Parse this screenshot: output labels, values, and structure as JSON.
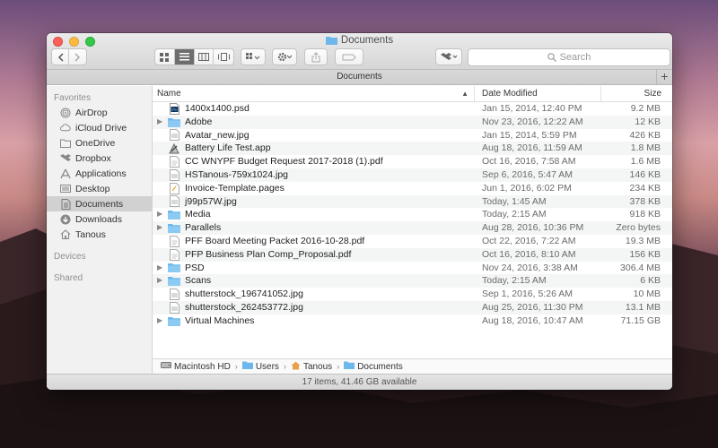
{
  "window": {
    "title": "Documents",
    "tab_label": "Documents",
    "search_placeholder": "Search",
    "status": "17 items, 41.46 GB available"
  },
  "sidebar": {
    "favorites_label": "Favorites",
    "devices_label": "Devices",
    "shared_label": "Shared",
    "items": [
      {
        "label": "AirDrop",
        "icon": "airdrop-icon"
      },
      {
        "label": "iCloud Drive",
        "icon": "cloud-icon"
      },
      {
        "label": "OneDrive",
        "icon": "folder-icon"
      },
      {
        "label": "Dropbox",
        "icon": "dropbox-icon"
      },
      {
        "label": "Applications",
        "icon": "applications-icon"
      },
      {
        "label": "Desktop",
        "icon": "desktop-icon"
      },
      {
        "label": "Documents",
        "icon": "documents-icon"
      },
      {
        "label": "Downloads",
        "icon": "downloads-icon"
      },
      {
        "label": "Tanous",
        "icon": "home-icon"
      }
    ]
  },
  "columns": {
    "name": "Name",
    "date": "Date Modified",
    "size": "Size"
  },
  "files": [
    {
      "name": "1400x1400.psd",
      "date": "Jan 15, 2014, 12:40 PM",
      "size": "9.2 MB",
      "kind": "psd",
      "folder": false
    },
    {
      "name": "Adobe",
      "date": "Nov 23, 2016, 12:22 AM",
      "size": "12 KB",
      "kind": "folder",
      "folder": true
    },
    {
      "name": "Avatar_new.jpg",
      "date": "Jan 15, 2014, 5:59 PM",
      "size": "426 KB",
      "kind": "image",
      "folder": false
    },
    {
      "name": "Battery Life Test.app",
      "date": "Aug 18, 2016, 11:59 AM",
      "size": "1.8 MB",
      "kind": "app",
      "folder": false
    },
    {
      "name": "CC WNYPF Budget Request 2017-2018 (1).pdf",
      "date": "Oct 16, 2016, 7:58 AM",
      "size": "1.6 MB",
      "kind": "pdf",
      "folder": false
    },
    {
      "name": "HSTanous-759x1024.jpg",
      "date": "Sep 6, 2016, 5:47 AM",
      "size": "146 KB",
      "kind": "image",
      "folder": false
    },
    {
      "name": "Invoice-Template.pages",
      "date": "Jun 1, 2016, 6:02 PM",
      "size": "234 KB",
      "kind": "doc",
      "folder": false
    },
    {
      "name": "j99p57W.jpg",
      "date": "Today, 1:45 AM",
      "size": "378 KB",
      "kind": "image",
      "folder": false
    },
    {
      "name": "Media",
      "date": "Today, 2:15 AM",
      "size": "918 KB",
      "kind": "folder",
      "folder": true
    },
    {
      "name": "Parallels",
      "date": "Aug 28, 2016, 10:36 PM",
      "size": "Zero bytes",
      "kind": "folder",
      "folder": true
    },
    {
      "name": "PFF Board Meeting Packet 2016-10-28.pdf",
      "date": "Oct 22, 2016, 7:22 AM",
      "size": "19.3 MB",
      "kind": "pdf",
      "folder": false
    },
    {
      "name": "PFP Business Plan Comp_Proposal.pdf",
      "date": "Oct 16, 2016, 8:10 AM",
      "size": "156 KB",
      "kind": "pdf",
      "folder": false
    },
    {
      "name": "PSD",
      "date": "Nov 24, 2016, 3:38 AM",
      "size": "306.4 MB",
      "kind": "folder",
      "folder": true
    },
    {
      "name": "Scans",
      "date": "Today, 2:15 AM",
      "size": "6 KB",
      "kind": "folder",
      "folder": true
    },
    {
      "name": "shutterstock_196741052.jpg",
      "date": "Sep 1, 2016, 5:26 AM",
      "size": "10 MB",
      "kind": "image",
      "folder": false
    },
    {
      "name": "shutterstock_262453772.jpg",
      "date": "Aug 25, 2016, 11:30 PM",
      "size": "13.1 MB",
      "kind": "image",
      "folder": false
    },
    {
      "name": "Virtual Machines",
      "date": "Aug 18, 2016, 10:47 AM",
      "size": "71.15 GB",
      "kind": "folder",
      "folder": true
    }
  ],
  "path": [
    {
      "label": "Macintosh HD",
      "icon": "hard-drive-icon"
    },
    {
      "label": "Users",
      "icon": "folder-icon"
    },
    {
      "label": "Tanous",
      "icon": "home-icon"
    },
    {
      "label": "Documents",
      "icon": "folder-icon"
    }
  ],
  "colors": {
    "folder_blue": "#6cb8ec",
    "selection_gray": "#d1d1d1"
  }
}
